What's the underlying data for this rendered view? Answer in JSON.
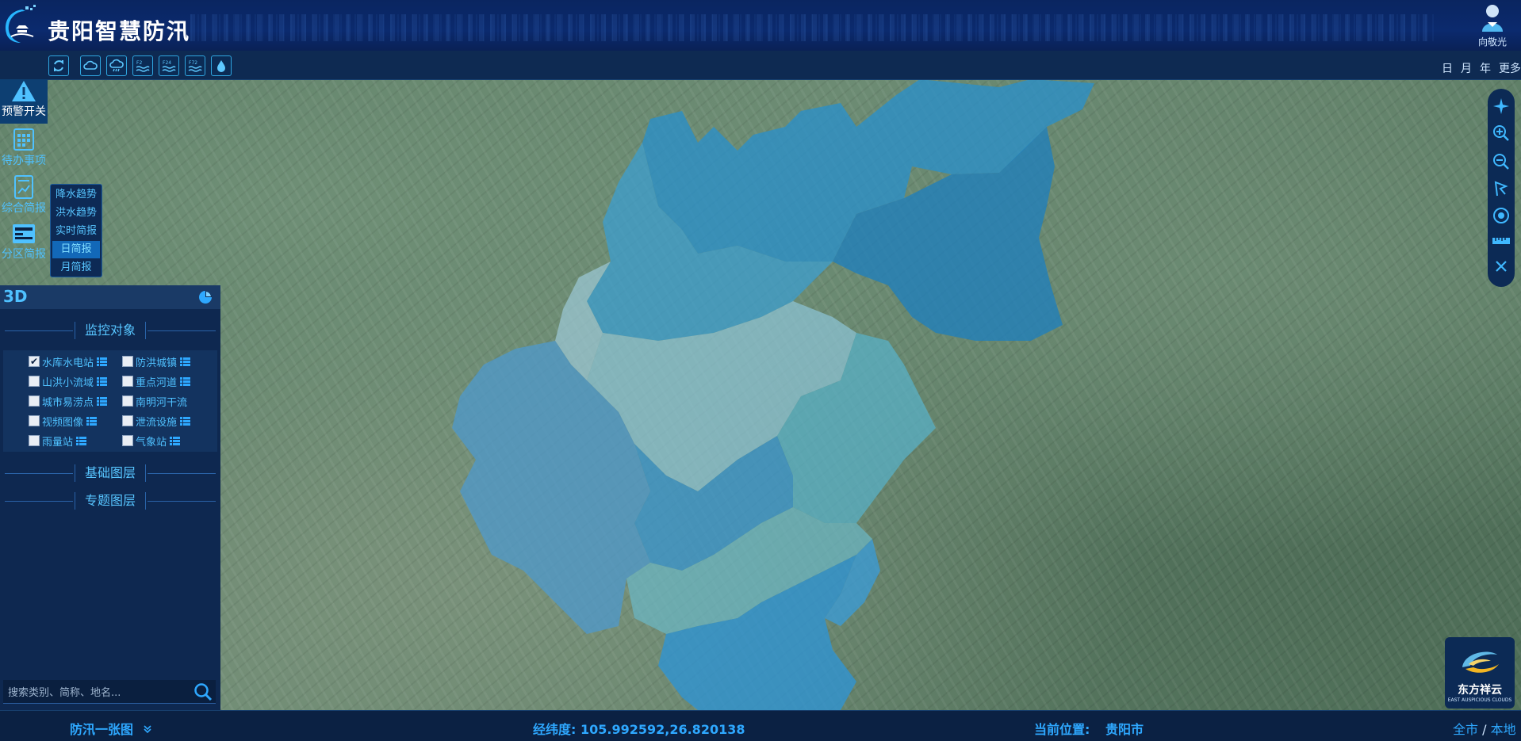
{
  "app": {
    "title": "贵阳智慧防汛"
  },
  "user": {
    "name": "向敬光"
  },
  "toolbar": {
    "buttons": [
      "sync",
      "cloud",
      "rain-cloud",
      "f2-wave",
      "f24-wave",
      "f72-wave",
      "water-drop"
    ],
    "wave_labels": {
      "f2": "F2",
      "f24": "F24",
      "f72": "F72"
    },
    "time_links": [
      "日",
      "月",
      "年",
      "更多"
    ]
  },
  "rail": {
    "items": [
      {
        "label": "预警开关",
        "icon": "warning-icon"
      },
      {
        "label": "待办事项",
        "icon": "calendar-icon"
      },
      {
        "label": "综合简报",
        "icon": "report-icon"
      },
      {
        "label": "分区简报",
        "icon": "zone-report-icon"
      }
    ]
  },
  "flyout": {
    "items": [
      "降水趋势",
      "洪水趋势",
      "实时简报",
      "日简报",
      "月简报"
    ],
    "active": "日简报"
  },
  "panel": {
    "mode": "3D",
    "sections": {
      "monitor": "监控对象",
      "base": "基础图层",
      "theme": "专题图层"
    },
    "monitor_items": [
      {
        "label": "水库水电站",
        "checked": true,
        "has_list": true
      },
      {
        "label": "防洪城镇",
        "checked": false,
        "has_list": true
      },
      {
        "label": "山洪小流域",
        "checked": false,
        "has_list": true
      },
      {
        "label": "重点河道",
        "checked": false,
        "has_list": true
      },
      {
        "label": "城市易涝点",
        "checked": false,
        "has_list": true
      },
      {
        "label": "南明河干流",
        "checked": false,
        "has_list": false
      },
      {
        "label": "视频图像",
        "checked": false,
        "has_list": true
      },
      {
        "label": "泄流设施",
        "checked": false,
        "has_list": true
      },
      {
        "label": "雨量站",
        "checked": false,
        "has_list": true
      },
      {
        "label": "气象站",
        "checked": false,
        "has_list": true
      }
    ],
    "search_placeholder": "搜索类别、简称、地名..."
  },
  "map_tools": [
    "compass-icon",
    "zoom-in-icon",
    "zoom-out-icon",
    "draw-polygon-icon",
    "locate-icon",
    "ruler-icon",
    "close-icon"
  ],
  "brand": {
    "name": "东方祥云",
    "sub": "EAST AUSPICIOUS CLOUDS"
  },
  "status": {
    "view_label": "防汛一张图",
    "coord_label": "经纬度:",
    "coord_value": "105.992592,26.820138",
    "location_label": "当前位置:",
    "location_value": "贵阳市",
    "scope_all": "全市",
    "scope_sep": "/",
    "scope_local": "本地"
  },
  "colors": {
    "accent": "#2ea8ff",
    "header": "#0b2a6e",
    "panel": "#0e2850"
  }
}
